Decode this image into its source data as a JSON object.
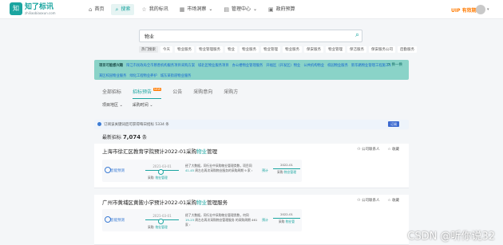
{
  "app": {
    "logo_cn": "知了标讯",
    "logo_en": "zhiliaobiaoxun.com",
    "logo_mark": "知"
  },
  "nav": [
    {
      "icon": "⌂",
      "label": "首页"
    },
    {
      "icon": "⌕",
      "label": "搜索"
    },
    {
      "icon": "☆",
      "label": "我的标讯"
    },
    {
      "icon": "▦",
      "label": "市场洞察"
    },
    {
      "icon": "▤",
      "label": "管理中心"
    },
    {
      "icon": "▣",
      "label": "政府预算"
    }
  ],
  "user": {
    "vip": "UIP 有效期"
  },
  "search": {
    "value": "物业",
    "hot_tags": [
      "热门搜索",
      "今天",
      "物业服务",
      "物业管理服务",
      "物业",
      "物业服务",
      "物业管理",
      "物业服务",
      "保安服务",
      "物业管理",
      "保洁服务",
      "保安服务公司",
      "后勤服务",
      "保洁服务",
      "前期物业"
    ]
  },
  "banner": {
    "title": "项目可能感兴趣",
    "items": [
      "阳江市民政局全市慈善机构服务项目采购方案",
      "城北区物业服务项目",
      "办公楼物业管理服务",
      "开福区（开发区）物业",
      "公共机构物业",
      "校园物业服务",
      "新华路物业管理工程施工1",
      "某区校园物业服务",
      "绿化工程物业养护",
      "城东某街道物业服务"
    ],
    "more": "⟳ 换一换"
  },
  "tabs": [
    {
      "label": "全部招标"
    },
    {
      "label": "招标预告",
      "badge": "NEW"
    },
    {
      "label": "公告"
    },
    {
      "label": "采购意向"
    },
    {
      "label": "采购方"
    }
  ],
  "filters": [
    {
      "label": "项目地区 ⌄"
    },
    {
      "label": "采购时间 ⌄"
    }
  ],
  "subscribe": {
    "text": "订阅该关键词后可获得每日招标 5334 条",
    "button": "订阅"
  },
  "latest": {
    "prefix": "最新招标",
    "count": "7,074",
    "suffix": "条"
  },
  "cards": [
    {
      "title_pre": "上海市徐汇区教育学院预计2022-01采购",
      "title_hl": "物业",
      "title_post": "管理",
      "actions": [
        "公司联系人",
        "收藏"
      ],
      "tl_label": "智能预测",
      "tl_date": "2021-03-01",
      "tl_b1": "采购",
      "tl_b2": "物业管理",
      "desc_a": "经了大数据，同行业中采购物业管理类",
      "desc_b": "数，项目同",
      "desc_num": "41-45",
      "desc_c": "周左右再次采购物业服务的采购周期 9 家 ›",
      "pred": "预计",
      "pred_date": "2022-01",
      "pred_label1": "采购",
      "pred_label2": "物业管理"
    },
    {
      "title_pre": "广州市黄埔区黄陂小学预计2022-01采购",
      "title_hl": "物业",
      "title_post": "管理服务",
      "actions": [
        "公司联系人",
        "收藏"
      ],
      "tl_label": "智能预测",
      "tl_date": "2021-03-01",
      "tl_b1": "采购",
      "tl_b2": "物业管理",
      "desc_a": "经了大数据，同行业中采购物业管理类",
      "desc_b": "数，何同",
      "desc_num": "19-23",
      "desc_c": "周左右再次采购物业管理服务 的采购周期 461 家 ›",
      "pred": "预计",
      "pred_date": "2022-01",
      "pred_label1": "采购",
      "pred_label2": "物业管"
    }
  ],
  "watermark": "CSDN @听你说32"
}
